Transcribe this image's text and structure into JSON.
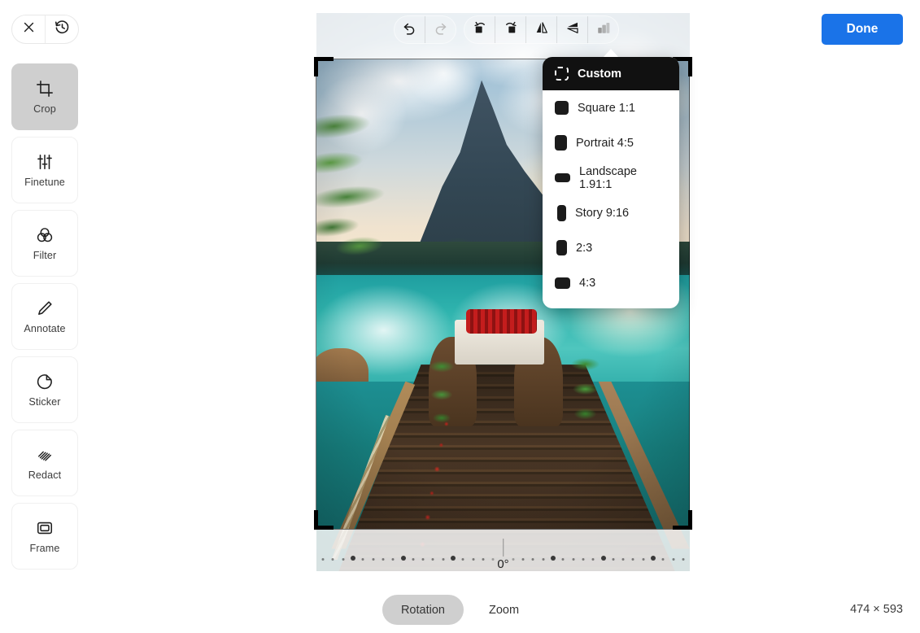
{
  "header": {
    "close_label": "close-icon",
    "revert_label": "revert-icon",
    "done_label": "Done"
  },
  "sidebar": {
    "items": [
      {
        "label": "Crop",
        "icon": "crop-icon",
        "active": true
      },
      {
        "label": "Finetune",
        "icon": "sliders-icon",
        "active": false
      },
      {
        "label": "Filter",
        "icon": "filter-icon",
        "active": false
      },
      {
        "label": "Annotate",
        "icon": "pencil-icon",
        "active": false
      },
      {
        "label": "Sticker",
        "icon": "sticker-icon",
        "active": false
      },
      {
        "label": "Redact",
        "icon": "hatch-icon",
        "active": false
      },
      {
        "label": "Frame",
        "icon": "frame-icon",
        "active": false
      }
    ]
  },
  "toolbar": {
    "undo": "undo-icon",
    "redo": "redo-icon",
    "rotate_left": "rotate-left-icon",
    "rotate_right": "rotate-right-icon",
    "flip_horizontal": "flip-horizontal-icon",
    "flip_vertical": "flip-vertical-icon",
    "aspect_ratio": "aspect-ratio-icon"
  },
  "aspect_menu": {
    "selected": "Custom",
    "items": [
      {
        "label": "Custom",
        "icon": "dashed-square-icon",
        "selected": true,
        "w": 17,
        "h": 17
      },
      {
        "label": "Square 1:1",
        "icon": "square-icon",
        "selected": false,
        "w": 17,
        "h": 17
      },
      {
        "label": "Portrait 4:5",
        "icon": "portrait-icon",
        "selected": false,
        "w": 15,
        "h": 19
      },
      {
        "label": "Landscape 1.91:1",
        "icon": "landscape-icon",
        "selected": false,
        "w": 19,
        "h": 11
      },
      {
        "label": "Story 9:16",
        "icon": "story-icon",
        "selected": false,
        "w": 11,
        "h": 20
      },
      {
        "label": "2:3",
        "icon": "ratio-2-3-icon",
        "selected": false,
        "w": 13,
        "h": 19
      },
      {
        "label": "4:3",
        "icon": "ratio-4-3-icon",
        "selected": false,
        "w": 19,
        "h": 14
      }
    ]
  },
  "rotation": {
    "value_label": "0°",
    "value": 0
  },
  "modes": [
    {
      "label": "Rotation",
      "active": true
    },
    {
      "label": "Zoom",
      "active": false
    }
  ],
  "status": {
    "dimensions": "474 × 593"
  },
  "colors": {
    "accent": "#1a73e8",
    "active_tool_bg": "#cfcfcf",
    "menu_selected_bg": "#111111"
  }
}
